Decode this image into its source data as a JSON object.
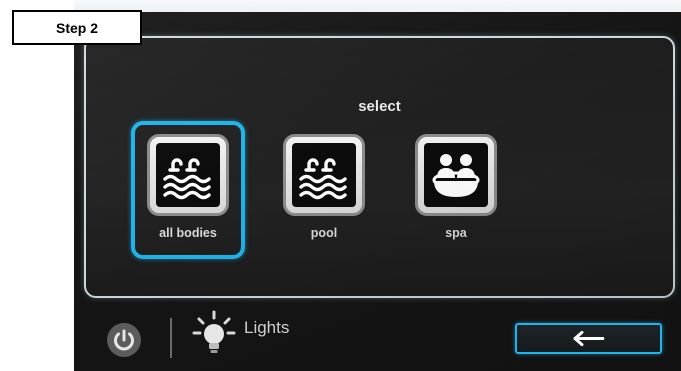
{
  "step_badge": "Step 2",
  "title": "select",
  "options": [
    {
      "label": "all bodies",
      "icon": "pool-icon",
      "selected": true
    },
    {
      "label": "pool",
      "icon": "pool-icon",
      "selected": false
    },
    {
      "label": "spa",
      "icon": "spa-icon",
      "selected": false
    }
  ],
  "bottom_bar": {
    "lights_label": "Lights",
    "power_icon": "power-icon",
    "lights_icon": "lightbulb-icon",
    "back_icon": "left-arrow-icon"
  },
  "colors": {
    "accent": "#1fb4ec",
    "panel_border": "#cfd9e0",
    "background": "#151515"
  }
}
